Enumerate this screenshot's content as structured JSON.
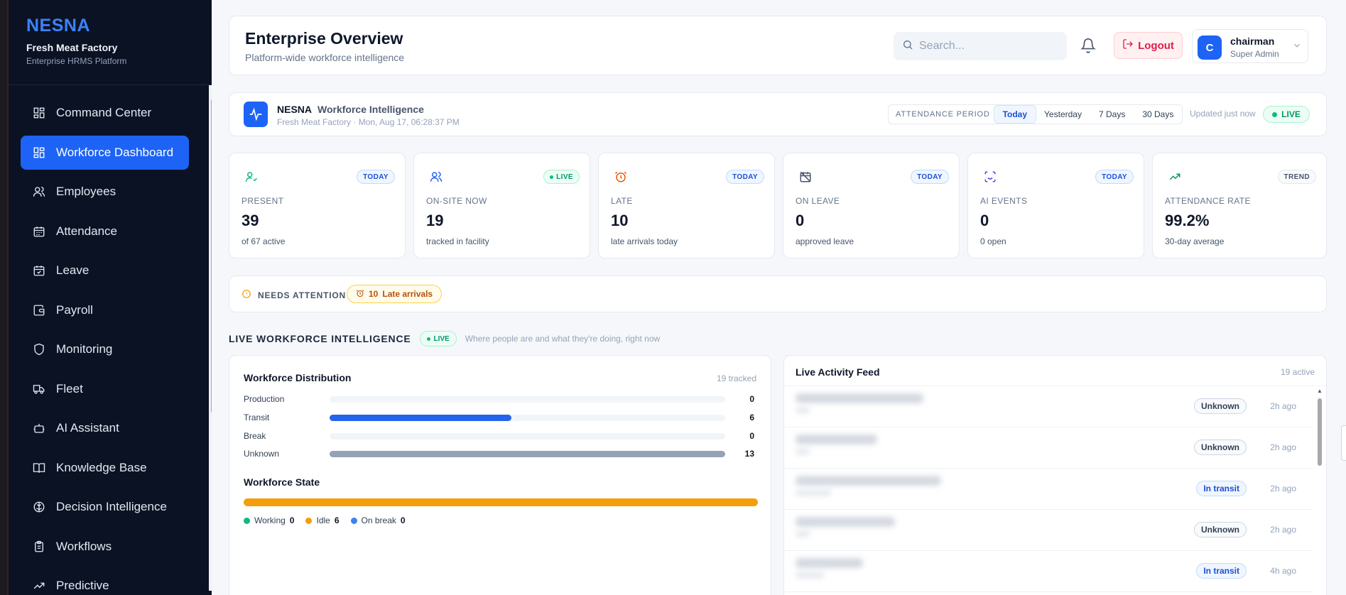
{
  "sidebar": {
    "brand": "NESNA",
    "company": "Fresh Meat Factory",
    "platform": "Enterprise HRMS Platform",
    "items": [
      {
        "label": "Command Center",
        "icon": "grid-icon"
      },
      {
        "label": "Workforce Dashboard",
        "icon": "grid-icon",
        "active": true
      },
      {
        "label": "Employees",
        "icon": "users-icon"
      },
      {
        "label": "Attendance",
        "icon": "calendar-icon"
      },
      {
        "label": "Leave",
        "icon": "calendar-check-icon"
      },
      {
        "label": "Payroll",
        "icon": "wallet-icon"
      },
      {
        "label": "Monitoring",
        "icon": "shield-icon"
      },
      {
        "label": "Fleet",
        "icon": "truck-icon"
      },
      {
        "label": "AI Assistant",
        "icon": "bot-icon"
      },
      {
        "label": "Knowledge Base",
        "icon": "book-icon"
      },
      {
        "label": "Decision Intelligence",
        "icon": "brain-icon"
      },
      {
        "label": "Workflows",
        "icon": "clipboard-icon"
      },
      {
        "label": "Predictive",
        "icon": "trend-icon"
      }
    ]
  },
  "header": {
    "title": "Enterprise Overview",
    "subtitle": "Platform-wide workforce intelligence",
    "search_placeholder": "Search...",
    "logout": "Logout",
    "user": {
      "initial": "C",
      "name": "chairman",
      "role": "Super Admin"
    }
  },
  "intel": {
    "brand": "NESNA",
    "title": "Workforce Intelligence",
    "subtitle": "Fresh Meat Factory · Mon, Aug 17, 06:28:37 PM",
    "period_label": "ATTENDANCE PERIOD",
    "periods": [
      "Today",
      "Yesterday",
      "7 Days",
      "30 Days"
    ],
    "selected_period": "Today",
    "updated": "Updated just now",
    "live": "LIVE"
  },
  "stats": [
    {
      "badge": "TODAY",
      "label": "PRESENT",
      "value": "39",
      "note": "of 67 active",
      "icon": "user-check-icon",
      "color": "#10b981"
    },
    {
      "badge": "LIVE",
      "label": "ON-SITE NOW",
      "value": "19",
      "note": "tracked in facility",
      "icon": "users-icon",
      "color": "#2563eb"
    },
    {
      "badge": "TODAY",
      "label": "LATE",
      "value": "10",
      "note": "late arrivals today",
      "icon": "alarm-icon",
      "color": "#ea580c"
    },
    {
      "badge": "TODAY",
      "label": "ON LEAVE",
      "value": "0",
      "note": "approved leave",
      "icon": "calendar-off-icon",
      "color": "#475569"
    },
    {
      "badge": "TODAY",
      "label": "AI EVENTS",
      "value": "0",
      "note": "0 open",
      "icon": "scan-face-icon",
      "color": "#4f46e5"
    },
    {
      "badge": "TREND",
      "label": "ATTENDANCE RATE",
      "value": "99.2%",
      "note": "30-day average",
      "icon": "trend-up-icon",
      "color": "#059669"
    }
  ],
  "attention": {
    "label": "NEEDS ATTENTION",
    "count": "10",
    "text": "Late arrivals"
  },
  "live_section": {
    "title": "LIVE WORKFORCE INTELLIGENCE",
    "badge": "LIVE",
    "desc": "Where people are and what they're doing, right now"
  },
  "distribution": {
    "title": "Workforce Distribution",
    "tracked": "19 tracked",
    "rows": [
      {
        "label": "Production",
        "count": 0,
        "fraction": 0,
        "color": "#94a3b8"
      },
      {
        "label": "Transit",
        "count": 6,
        "fraction": 0.46,
        "color": "#2563eb"
      },
      {
        "label": "Break",
        "count": 0,
        "fraction": 0,
        "color": "#94a3b8"
      },
      {
        "label": "Unknown",
        "count": 13,
        "fraction": 1.0,
        "color": "#94a3b8"
      }
    ],
    "state_title": "Workforce State",
    "state": [
      {
        "label": "Working",
        "count": "0",
        "color": "#10b981"
      },
      {
        "label": "Idle",
        "count": "6",
        "color": "#f59e0b"
      },
      {
        "label": "On break",
        "count": "0",
        "color": "#3b82f6"
      }
    ]
  },
  "feed": {
    "title": "Live Activity Feed",
    "count": "19 active",
    "items": [
      {
        "status": "Unknown",
        "time": "2h ago"
      },
      {
        "status": "Unknown",
        "time": "2h ago"
      },
      {
        "status": "In transit",
        "time": "2h ago"
      },
      {
        "status": "Unknown",
        "time": "2h ago"
      },
      {
        "status": "In transit",
        "time": "4h ago"
      }
    ]
  }
}
